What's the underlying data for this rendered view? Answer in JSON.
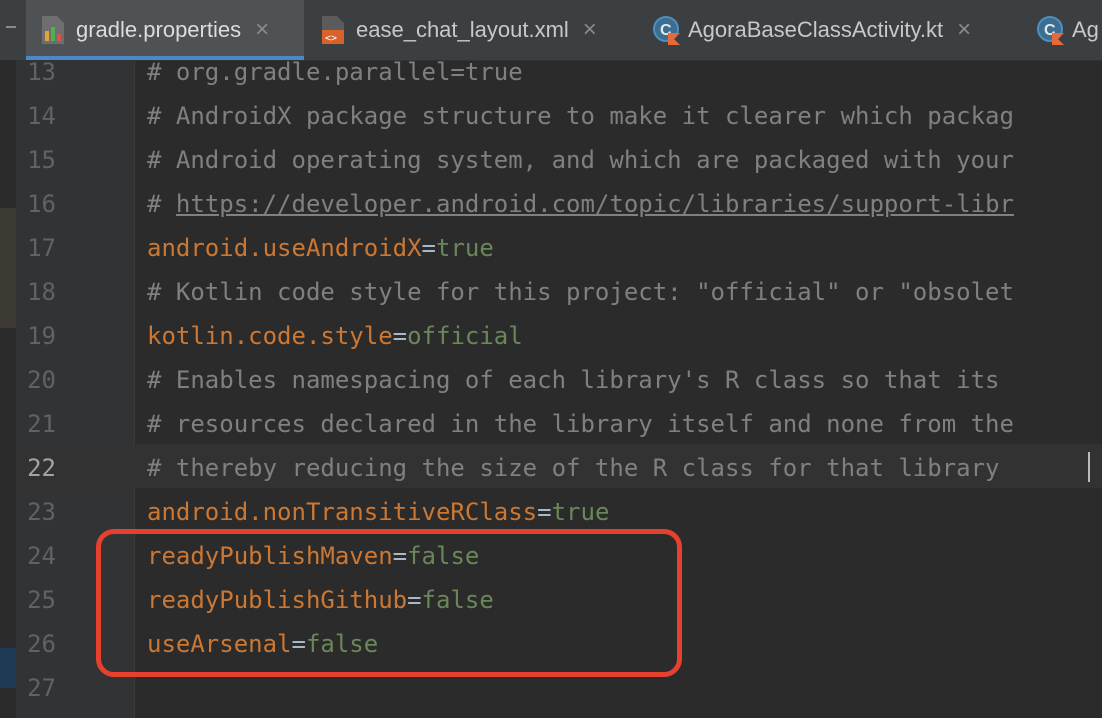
{
  "tabs": [
    {
      "label": "gradle.properties",
      "icon": "gradle-properties-icon",
      "active": true
    },
    {
      "label": "ease_chat_layout.xml",
      "icon": "xml-file-icon",
      "active": false
    },
    {
      "label": "AgoraBaseClassActivity.kt",
      "icon": "kotlin-class-icon",
      "active": false
    },
    {
      "label": "Ag",
      "icon": "kotlin-class-icon",
      "active": false
    }
  ],
  "editor": {
    "current_line": "22",
    "lines": [
      {
        "num": "13",
        "text": "# org.gradle.parallel=true"
      },
      {
        "num": "14",
        "text": "# AndroidX package structure to make it clearer which packag"
      },
      {
        "num": "15",
        "text": "# Android operating system, and which are packaged with your"
      },
      {
        "num": "16",
        "prefix": "# ",
        "link": "https://developer.android.com/topic/libraries/support-libr"
      },
      {
        "num": "17",
        "key": "android.useAndroidX",
        "value": "true"
      },
      {
        "num": "18",
        "text": "# Kotlin code style for this project: \"official\" or \"obsolet"
      },
      {
        "num": "19",
        "key": "kotlin.code.style",
        "value": "official"
      },
      {
        "num": "20",
        "text": "# Enables namespacing of each library's R class so that its"
      },
      {
        "num": "21",
        "text": "# resources declared in the library itself and none from the"
      },
      {
        "num": "22",
        "text": "# thereby reducing the size of the R class for that library"
      },
      {
        "num": "23",
        "key": "android.nonTransitiveRClass",
        "value": "true"
      },
      {
        "num": "24",
        "key": "readyPublishMaven",
        "value": "false"
      },
      {
        "num": "25",
        "key": "readyPublishGithub",
        "value": "false"
      },
      {
        "num": "26",
        "key": "useArsenal",
        "value": "false"
      },
      {
        "num": "27",
        "text": ""
      }
    ],
    "eq": "="
  },
  "colors": {
    "background": "#2b2b2b",
    "comment": "#808080",
    "key": "#cc7832",
    "value": "#6a8759",
    "highlight_box": "#e8402f"
  }
}
